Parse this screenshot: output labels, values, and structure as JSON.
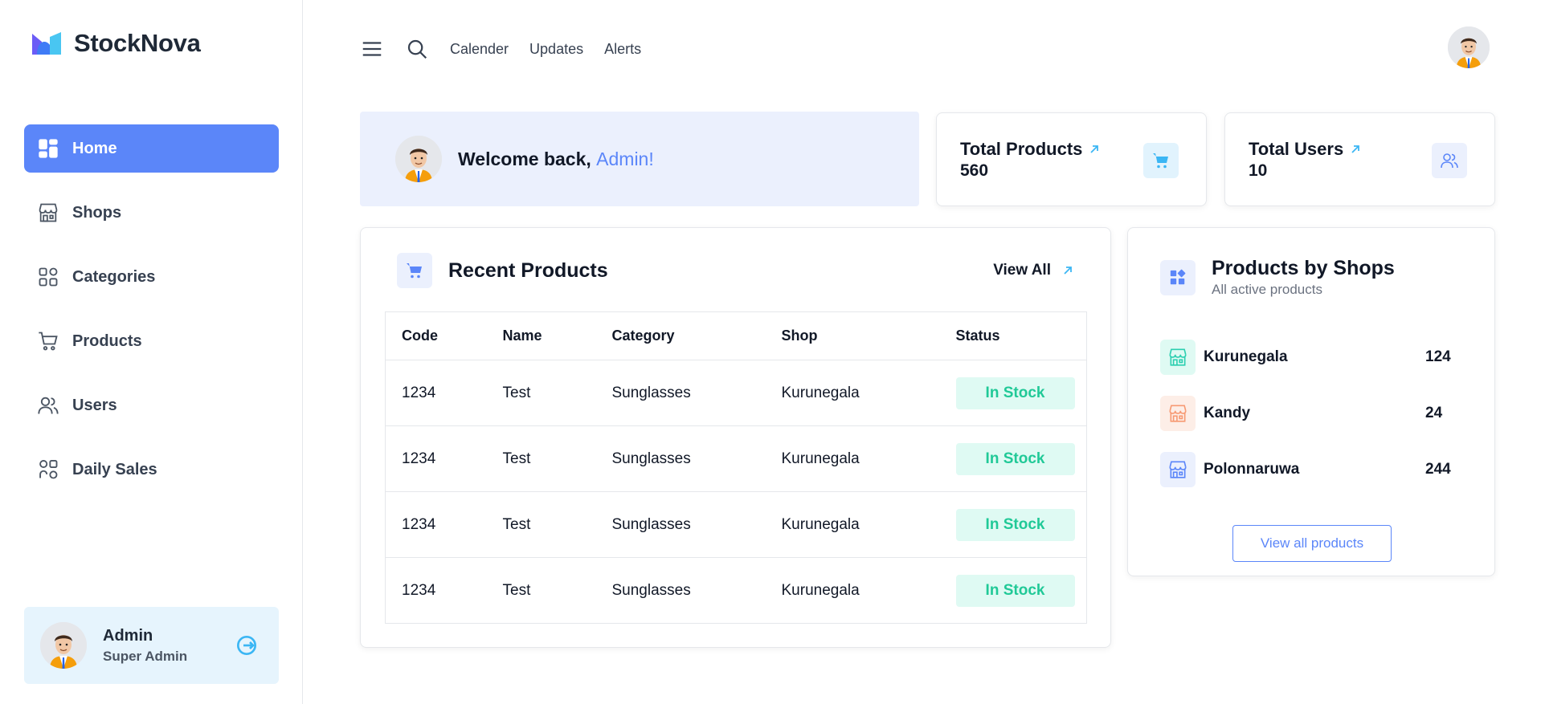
{
  "brand": {
    "name": "StockNova"
  },
  "sidebar": {
    "items": [
      {
        "label": "Home",
        "icon": "dashboard-icon",
        "active": true
      },
      {
        "label": "Shops",
        "icon": "store-icon"
      },
      {
        "label": "Categories",
        "icon": "categories-icon"
      },
      {
        "label": "Products",
        "icon": "cart-icon"
      },
      {
        "label": "Users",
        "icon": "users-icon"
      },
      {
        "label": "Daily Sales",
        "icon": "daily-sales-icon"
      }
    ],
    "user": {
      "name": "Admin",
      "role": "Super Admin",
      "logout_icon": "logout-icon"
    }
  },
  "topbar": {
    "links": [
      "Calender",
      "Updates",
      "Alerts"
    ],
    "icons": [
      "menu-icon",
      "search-icon"
    ]
  },
  "welcome": {
    "prefix": "Welcome back,",
    "name": "Admin!"
  },
  "stats": [
    {
      "label": "Total Products",
      "value": "560",
      "icon": "cart-icon",
      "icon_bg": "#e1f3fd",
      "icon_color": "#3bb6f4"
    },
    {
      "label": "Total Users",
      "value": "10",
      "icon": "users-icon",
      "icon_bg": "#ebf0fd",
      "icon_color": "#5b86f9"
    }
  ],
  "recent_products": {
    "title": "Recent Products",
    "view_all": "View All",
    "columns": [
      "Code",
      "Name",
      "Category",
      "Shop",
      "Status"
    ],
    "rows": [
      {
        "code": "1234",
        "name": "Test",
        "category": "Sunglasses",
        "shop": "Kurunegala",
        "status": "In Stock"
      },
      {
        "code": "1234",
        "name": "Test",
        "category": "Sunglasses",
        "shop": "Kurunegala",
        "status": "In Stock"
      },
      {
        "code": "1234",
        "name": "Test",
        "category": "Sunglasses",
        "shop": "Kurunegala",
        "status": "In Stock"
      },
      {
        "code": "1234",
        "name": "Test",
        "category": "Sunglasses",
        "shop": "Kurunegala",
        "status": "In Stock"
      }
    ]
  },
  "products_by_shops": {
    "title": "Products by Shops",
    "subtitle": "All active products",
    "shops": [
      {
        "name": "Kurunegala",
        "count": "124",
        "color": "#2ccfb0",
        "bg": "#dffaf3"
      },
      {
        "name": "Kandy",
        "count": "24",
        "color": "#f79a73",
        "bg": "#fdeee7"
      },
      {
        "name": "Polonnaruwa",
        "count": "244",
        "color": "#5b86f9",
        "bg": "#ebf0fd"
      }
    ],
    "button": "View all products"
  },
  "colors": {
    "accent": "#5b86f9",
    "success": "#20c997",
    "success_bg": "#dffaf3"
  }
}
